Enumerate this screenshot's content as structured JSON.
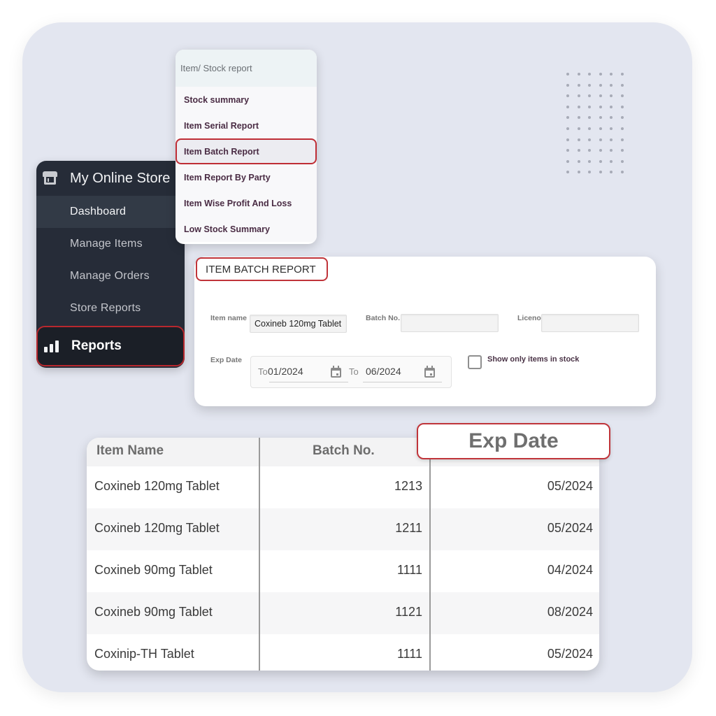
{
  "sidebar": {
    "store_name": "My Online Store",
    "store_icon": "store-icon",
    "items": [
      {
        "label": "Dashboard",
        "active": true
      },
      {
        "label": "Manage Items"
      },
      {
        "label": "Manage Orders"
      },
      {
        "label": "Store Reports"
      }
    ],
    "reports": {
      "label": "Reports",
      "icon": "bar-chart-icon",
      "highlighted": true
    }
  },
  "menu": {
    "header": "Item/ Stock report",
    "items": [
      {
        "label": "Stock summary"
      },
      {
        "label": "Item Serial Report"
      },
      {
        "label": "Item Batch Report",
        "selected": true
      },
      {
        "label": "Item Report By Party"
      },
      {
        "label": "Item Wise Profit And Loss"
      },
      {
        "label": "Low Stock Summary"
      }
    ]
  },
  "form": {
    "title": "ITEM BATCH REPORT",
    "item_name_label": "Item name",
    "item_name_value": "Coxineb 120mg Tablet",
    "batch_no_label": "Batch No.",
    "batch_no_value": "",
    "licence_label": "Liceno",
    "licence_value": "",
    "exp_date_label": "Exp Date",
    "from_prefix": "To",
    "from_value": "01/2024",
    "to_prefix": "To",
    "to_value": "06/2024",
    "calendar_icon": "calendar-icon",
    "in_stock_label": "Show only items in stock",
    "in_stock_checked": false
  },
  "table": {
    "columns": [
      "Item Name",
      "Batch No.",
      "Exp Date"
    ],
    "rows": [
      [
        "Coxineb 120mg Tablet",
        "1213",
        "05/2024"
      ],
      [
        "Coxineb 120mg Tablet",
        "1211",
        "05/2024"
      ],
      [
        "Coxineb 90mg Tablet",
        "1111",
        "04/2024"
      ],
      [
        "Coxineb 90mg Tablet",
        "1121",
        "08/2024"
      ],
      [
        "Coxinip-TH Tablet",
        "1111",
        "05/2024"
      ]
    ]
  },
  "colors": {
    "highlight_border": "#c0343a",
    "sidebar_bg": "#262c38",
    "background": "#e3e6f0"
  }
}
